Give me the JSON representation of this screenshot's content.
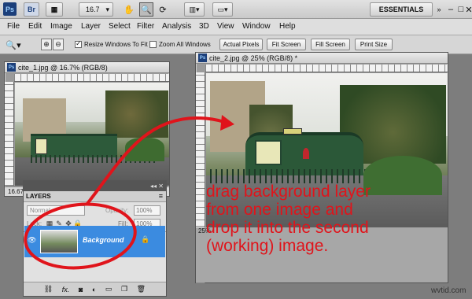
{
  "app": {
    "logo": "Ps",
    "bridge": "Br",
    "zoom_value": "16.7",
    "workspace": "ESSENTIALS"
  },
  "menu": [
    "File",
    "Edit",
    "Image",
    "Layer",
    "Select",
    "Filter",
    "Analysis",
    "3D",
    "View",
    "Window",
    "Help"
  ],
  "options": {
    "resize_label": "Resize Windows To Fit",
    "zoom_all_label": "Zoom All Windows",
    "actual_pixels": "Actual Pixels",
    "fit_screen": "Fit Screen",
    "fill_screen": "Fill Screen",
    "print_size": "Print Size"
  },
  "doc1": {
    "title": "cite_1.jpg @ 16.7% (RGB/8)",
    "zoom": "16.67"
  },
  "doc2": {
    "title": "cite_2.jpg @ 25% (RGB/8) *",
    "zoom": "25%"
  },
  "layers": {
    "tab": "LAYERS",
    "blend": "Normal",
    "opacity_label": "Opacity:",
    "opacity": "100%",
    "lock_label": "Lock:",
    "fill_label": "Fill:",
    "fill": "100%",
    "layer_name": "Background"
  },
  "icons": [
    "magnifier-icon",
    "zoom-in-icon",
    "zoom-out-icon",
    "hand-icon",
    "rotate-icon",
    "arrange-icon",
    "screen-mode-icon",
    "lock-icon",
    "link-icon",
    "fx-icon",
    "mask-icon",
    "adjustment-icon",
    "folder-icon",
    "new-layer-icon",
    "trash-icon",
    "eye-icon"
  ],
  "caption": [
    "drag background layer",
    "from one image and",
    "drop it into the second",
    "(working) image."
  ],
  "watermark": "wvtid.com",
  "colors": {
    "accent": "#e0141b",
    "selected_layer": "#3b8be0",
    "ps_blue": "#1c3f7a"
  }
}
